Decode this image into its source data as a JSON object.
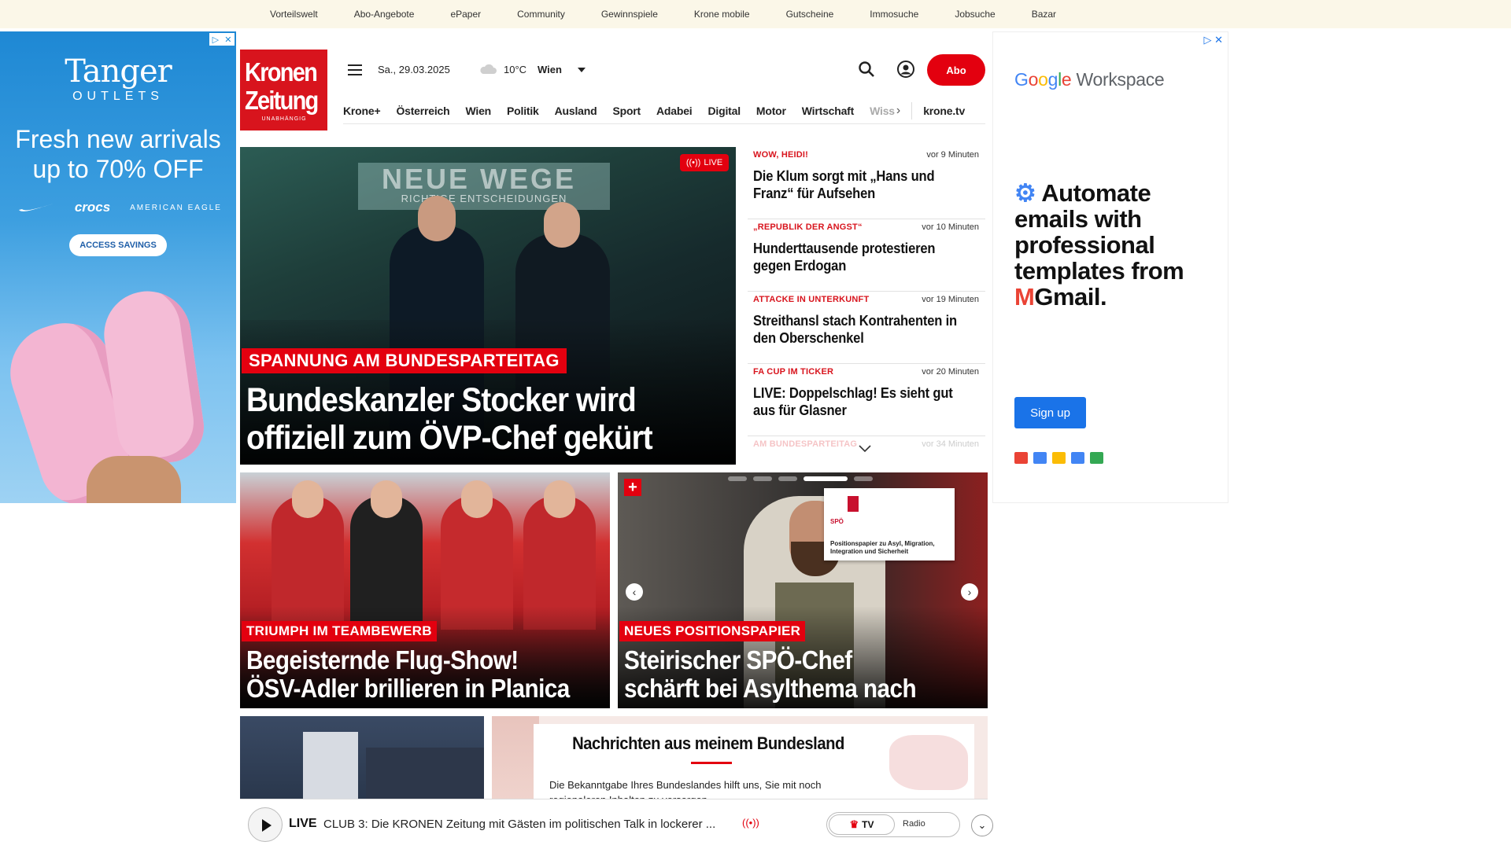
{
  "topbar": {
    "links": [
      "Vorteilswelt",
      "Abo-Angebote",
      "ePaper",
      "Community",
      "Gewinnspiele",
      "Krone mobile",
      "Gutscheine",
      "Immosuche",
      "Jobsuche",
      "Bazar"
    ]
  },
  "ad_left": {
    "brand": "Tanger",
    "brand_sub": "OUTLETS",
    "headline_1": "Fresh new arrivals",
    "headline_2": "up to 70% OFF",
    "brand_crocs": "crocs",
    "brand_ae": "AMERICAN EAGLE",
    "cta": "ACCESS SAVINGS"
  },
  "logo": {
    "line1": "Kronen",
    "line2": "Zeitung",
    "tagline": "UNABHÄNGIG"
  },
  "header": {
    "date": "Sa., 29.03.2025",
    "temperature": "10°C",
    "city": "Wien",
    "abo_label": "Abo"
  },
  "nav": {
    "items": [
      "Krone+",
      "Österreich",
      "Wien",
      "Politik",
      "Ausland",
      "Sport",
      "Adabei",
      "Digital",
      "Motor",
      "Wirtschaft"
    ],
    "faded_item": "Wiss",
    "tv_link": "krone.tv"
  },
  "hero": {
    "live_label": "LIVE",
    "banner_text": "NEUE WEGE",
    "banner_sub": "RICHTIGE ENTSCHEIDUNGEN",
    "kicker": "SPANNUNG AM BUNDESPARTEITAG",
    "title_1": "Bundeskanzler Stocker wird",
    "title_2": "offiziell zum ÖVP-Chef gekürt"
  },
  "news": [
    {
      "kicker": "WOW, HEIDI!",
      "time": "vor 9 Minuten",
      "headline": "Die Klum sorgt mit „Hans und Franz“ für Aufsehen"
    },
    {
      "kicker": "„REPUBLIK DER ANGST“",
      "time": "vor 10 Minuten",
      "headline": "Hunderttausende protestieren gegen Erdogan"
    },
    {
      "kicker": "ATTACKE IN UNTERKUNFT",
      "time": "vor 19 Minuten",
      "headline": "Streithansl stach Kontrahenten in den Oberschenkel"
    },
    {
      "kicker": "FA CUP IM TICKER",
      "time": "vor 20 Minuten",
      "headline": "LIVE: Doppelschlag! Es sieht gut aus für Glasner"
    },
    {
      "kicker": "AM BUNDESPARTEITAG",
      "time": "vor 34 Minuten",
      "headline": ""
    }
  ],
  "teaser1": {
    "kicker": "TRIUMPH IM TEAMBEWERB",
    "title_1": "Begeisternde Flug-Show!",
    "title_2": "ÖSV-Adler brillieren in Planica"
  },
  "teaser2": {
    "kicker": "NEUES POSITIONSPAPIER",
    "title_1": "Steirischer SPÖ-Chef",
    "title_2": "schärft bei Asylthema nach",
    "paper_party": "SPÖ",
    "paper_text": "Positionspapier zu Asyl, Migration, Integration und Sicherheit"
  },
  "bundesland": {
    "title": "Nachrichten aus meinem Bundesland",
    "text": "Die Bekanntgabe Ihres Bundeslandes hilft uns, Sie mit noch regionaleren Inhalten zu versorgen."
  },
  "player": {
    "live_label": "LIVE",
    "text": "CLUB 3: Die KRONEN Zeitung mit Gästen im politischen Talk in lockerer ...",
    "tv_label": "TV",
    "radio_label": "Radio"
  },
  "ad_right": {
    "brand_rest": "Workspace",
    "headline": "Automate emails with professional templates from",
    "gmail": "Gmail.",
    "cta": "Sign up"
  },
  "colors": {
    "brand_red": "#e3000f",
    "topbar_bg": "#fbf7e8",
    "google_blue": "#1a73e8"
  }
}
